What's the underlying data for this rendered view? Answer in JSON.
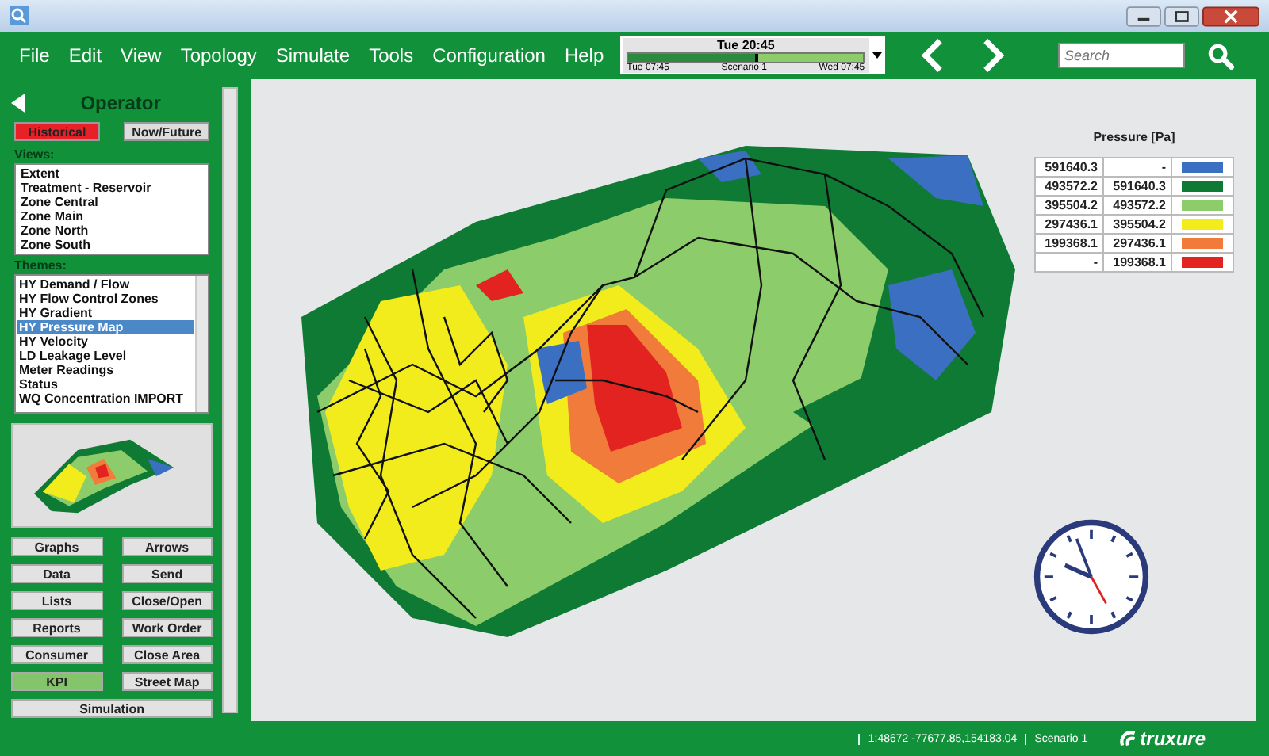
{
  "menu": [
    "File",
    "Edit",
    "View",
    "Topology",
    "Simulate",
    "Tools",
    "Configuration",
    "Help"
  ],
  "timeline": {
    "current": "Tue 20:45",
    "start": "Tue 07:45",
    "scenario": "Scenario 1",
    "end": "Wed 07:45",
    "level": 0.55
  },
  "search": {
    "placeholder": "Search"
  },
  "panel": {
    "title": "Operator",
    "modes": [
      {
        "label": "Historical",
        "selected": true
      },
      {
        "label": "Now/Future",
        "selected": false
      }
    ],
    "views_label": "Views:",
    "views": [
      "Extent",
      "Treatment - Reservoir",
      "Zone Central",
      "Zone Main",
      "Zone North",
      "Zone South"
    ],
    "themes_label": "Themes:",
    "themes": [
      {
        "label": "HY Demand / Flow",
        "selected": false
      },
      {
        "label": "HY Flow Control Zones",
        "selected": false
      },
      {
        "label": "HY Gradient",
        "selected": false
      },
      {
        "label": "HY Pressure Map",
        "selected": true
      },
      {
        "label": "HY Velocity",
        "selected": false
      },
      {
        "label": "LD Leakage Level",
        "selected": false
      },
      {
        "label": "Meter Readings",
        "selected": false
      },
      {
        "label": "Status",
        "selected": false
      },
      {
        "label": "WQ Concentration IMPORT",
        "selected": false
      }
    ],
    "buttons": [
      {
        "label": "Graphs",
        "selected": false
      },
      {
        "label": "Arrows",
        "selected": false
      },
      {
        "label": "Data",
        "selected": false
      },
      {
        "label": "Send",
        "selected": false
      },
      {
        "label": "Lists",
        "selected": false
      },
      {
        "label": "Close/Open",
        "selected": false
      },
      {
        "label": "Reports",
        "selected": false
      },
      {
        "label": "Work Order",
        "selected": false
      },
      {
        "label": "Consumer",
        "selected": false
      },
      {
        "label": "Close Area",
        "selected": false
      },
      {
        "label": "KPI",
        "selected": true
      },
      {
        "label": "Street Map",
        "selected": false
      }
    ],
    "simulation_button": "Simulation"
  },
  "legend": {
    "title": "Pressure [Pa]",
    "rows": [
      {
        "from": "591640.3",
        "to": "-",
        "color": "#3a6fc2"
      },
      {
        "from": "493572.2",
        "to": "591640.3",
        "color": "#0e7a34"
      },
      {
        "from": "395504.2",
        "to": "493572.2",
        "color": "#8ccc6a"
      },
      {
        "from": "297436.1",
        "to": "395504.2",
        "color": "#f2ec1c"
      },
      {
        "from": "199368.1",
        "to": "297436.1",
        "color": "#f07b3a"
      },
      {
        "from": "-",
        "to": "199368.1",
        "color": "#e2231f"
      }
    ]
  },
  "status_bar": {
    "coordinates": "1:48672 -77677.85,154183.04",
    "scenario": "Scenario 1",
    "logo": "truxure"
  }
}
